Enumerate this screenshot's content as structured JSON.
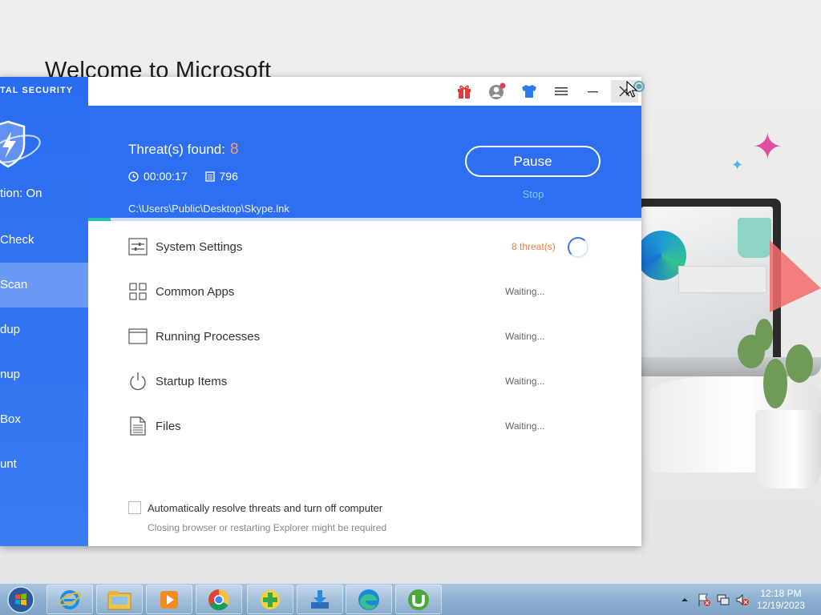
{
  "desktop": {
    "welcome_title": "Welcome to Microsoft"
  },
  "app": {
    "brand": "TAL SECURITY",
    "protection": "tion: On",
    "nav": [
      {
        "label": "Check",
        "active": false
      },
      {
        "label": "Scan",
        "active": true
      },
      {
        "label": "dup",
        "active": false
      },
      {
        "label": "nup",
        "active": false
      },
      {
        "label": "Box",
        "active": false
      },
      {
        "label": "unt",
        "active": false
      }
    ],
    "titlebar_icons": [
      "gift-icon",
      "account-icon",
      "skin-icon",
      "menu-icon",
      "minimize-icon",
      "close-icon"
    ],
    "header": {
      "threats_label": "Threat(s) found:",
      "threats_count": "8",
      "elapsed": "00:00:17",
      "files_scanned": "796",
      "scan_path": "C:\\Users\\Public\\Desktop\\Skype.lnk",
      "pause_label": "Pause",
      "stop_label": "Stop",
      "progress": 0.04
    },
    "scan_items": [
      {
        "label": "System Settings",
        "status": "8 threat(s)",
        "icon": "settings-sliders-icon",
        "state": "scanning"
      },
      {
        "label": "Common Apps",
        "status": "Waiting...",
        "icon": "apps-grid-icon",
        "state": "waiting"
      },
      {
        "label": "Running Processes",
        "status": "Waiting...",
        "icon": "window-icon",
        "state": "waiting"
      },
      {
        "label": "Startup Items",
        "status": "Waiting...",
        "icon": "power-icon",
        "state": "waiting"
      },
      {
        "label": "Files",
        "status": "Waiting...",
        "icon": "document-icon",
        "state": "waiting"
      }
    ],
    "auto_resolve": {
      "label": "Automatically resolve threats and turn off computer",
      "note": "Closing browser or restarting Explorer might be required",
      "checked": false
    },
    "colors": {
      "sidebar": "#2a6cef",
      "header": "#2e6ef0",
      "threat": "#ef7b3a",
      "stop": "#6fd3ff"
    }
  },
  "taskbar": {
    "apps": [
      "internet-explorer-icon",
      "file-explorer-icon",
      "media-player-icon",
      "chrome-icon",
      "green-plus-app-icon",
      "download-installer-icon",
      "edge-icon",
      "utorrent-icon"
    ],
    "time": "12:18 PM",
    "date": "12/19/2023"
  }
}
